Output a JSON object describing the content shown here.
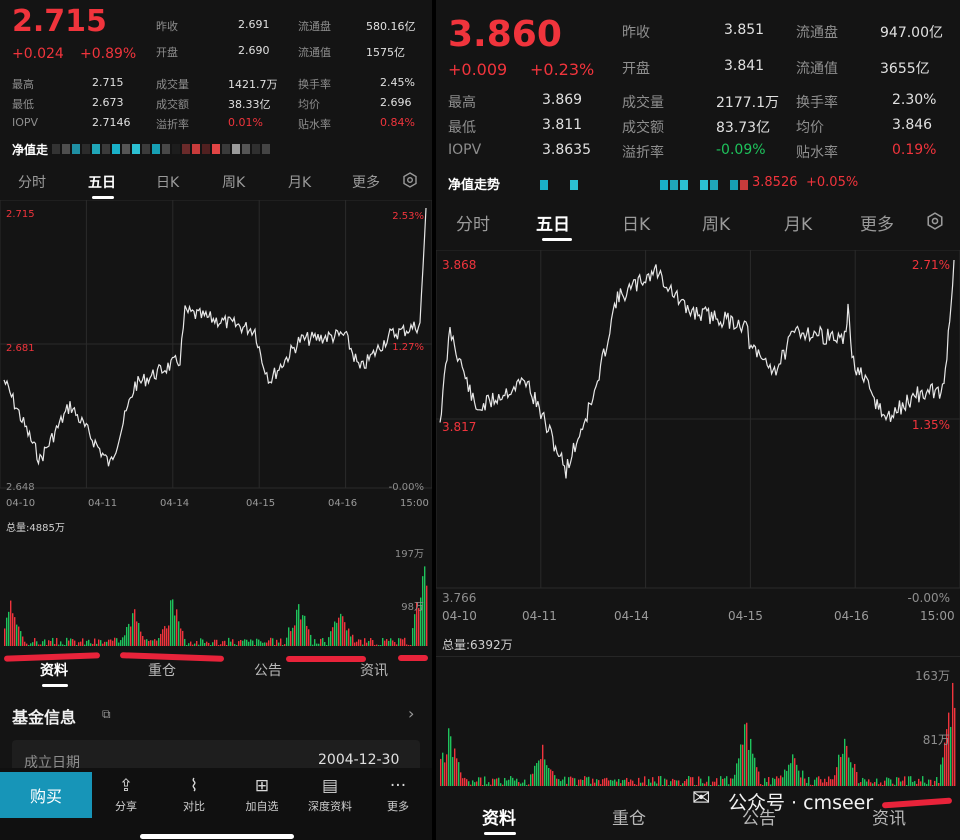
{
  "left": {
    "price": "2.715",
    "change": "+0.024",
    "change_pct": "+0.89%",
    "stats": [
      {
        "label": "昨收",
        "value": "2.691",
        "cls": "",
        "label2": "流通盘",
        "value2": "580.16亿",
        "cls2": ""
      },
      {
        "label": "开盘",
        "value": "2.690",
        "cls": "",
        "label2": "流通值",
        "value2": "1575亿",
        "cls2": ""
      }
    ],
    "stats2": [
      {
        "label": "最高",
        "value": "2.715",
        "label2": "成交量",
        "value2": "1421.7万",
        "label3": "换手率",
        "value3": "2.45%",
        "cls3": ""
      },
      {
        "label": "最低",
        "value": "2.673",
        "label2": "成交额",
        "value2": "38.33亿",
        "label3": "均价",
        "value3": "2.696",
        "cls3": ""
      },
      {
        "label": "IOPV",
        "value": "2.7146",
        "label2": "溢折率",
        "value2": "0.01%",
        "cls2": "red",
        "label3": "贴水率",
        "value3": "0.84%",
        "cls3": "red"
      }
    ],
    "nav_label": "净值走",
    "tabs": [
      "分时",
      "五日",
      "日K",
      "周K",
      "月K",
      "更多"
    ],
    "active_tab": "五日",
    "price_high": "2.715",
    "price_mid": "2.681",
    "price_low": "2.648",
    "pct_high": "2.53%",
    "pct_mid": "1.27%",
    "pct_low": "-0.00%",
    "dates": [
      "04-10",
      "04-11",
      "04-14",
      "04-15",
      "04-16",
      "15:00"
    ],
    "total_volume": "总量:4885万",
    "vol_high": "197万",
    "vol_mid": "98万",
    "bottom_tabs": [
      "资料",
      "重仓",
      "公告",
      "资讯"
    ],
    "fund_info_title": "基金信息",
    "inception_label": "成立日期",
    "inception_value": "2004-12-30",
    "buy_label": "购买",
    "bar_items": [
      {
        "icon": "⇪",
        "label": "分享",
        "name": "share"
      },
      {
        "icon": "⌇",
        "label": "对比",
        "name": "compare"
      },
      {
        "icon": "⊞",
        "label": "加自选",
        "name": "add-watchlist"
      },
      {
        "icon": "▤",
        "label": "深度资料",
        "name": "deep-info"
      },
      {
        "icon": "···",
        "label": "更多",
        "name": "more"
      }
    ]
  },
  "right": {
    "price": "3.860",
    "change": "+0.009",
    "change_pct": "+0.23%",
    "stats_top": [
      {
        "label": "昨收",
        "value": "3.851",
        "label2": "流通盘",
        "value2": "947.00亿"
      },
      {
        "label": "开盘",
        "value": "3.841",
        "label2": "流通值",
        "value2": "3655亿"
      }
    ],
    "stats2": [
      {
        "label": "最高",
        "value": "3.869",
        "label2": "成交量",
        "value2": "2177.1万",
        "cls2": "",
        "label3": "换手率",
        "value3": "2.30%",
        "cls3": ""
      },
      {
        "label": "最低",
        "value": "3.811",
        "label2": "成交额",
        "value2": "83.73亿",
        "cls2": "",
        "label3": "均价",
        "value3": "3.846",
        "cls3": ""
      },
      {
        "label": "IOPV",
        "value": "3.8635",
        "label2": "溢折率",
        "value2": "-0.09%",
        "cls2": "green",
        "label3": "贴水率",
        "value3": "0.19%",
        "cls3": "red"
      }
    ],
    "nav_label": "净值走势",
    "nav_value": "3.8526",
    "nav_change": "+0.05%",
    "tabs": [
      "分时",
      "五日",
      "日K",
      "周K",
      "月K",
      "更多"
    ],
    "active_tab": "五日",
    "price_high": "3.868",
    "price_mid": "3.817",
    "price_low": "3.766",
    "pct_high": "2.71%",
    "pct_mid": "1.35%",
    "pct_low": "-0.00%",
    "dates": [
      "04-10",
      "04-11",
      "04-14",
      "04-15",
      "04-16",
      "15:00"
    ],
    "total_volume": "总量:6392万",
    "vol_high": "163万",
    "vol_mid": "81万",
    "bottom_tabs": [
      "资料",
      "重仓",
      "公告",
      "资讯"
    ],
    "watermark": "公众号 · cmseer"
  },
  "colors": {
    "up": "#f0343c",
    "down": "#1ec35c",
    "accent": "#1795b8",
    "panel": "#141414"
  }
}
